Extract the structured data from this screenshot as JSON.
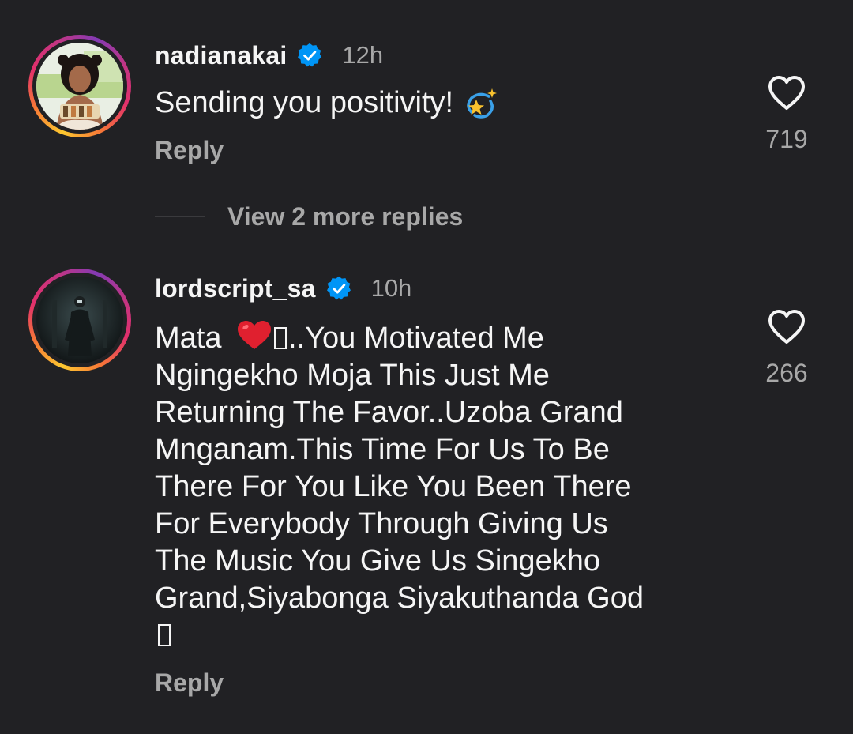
{
  "comments": [
    {
      "username": "nadianakai",
      "verified": true,
      "timestamp": "12h",
      "text": "Sending you positivity!",
      "emoji": "dizzy-star-emoji",
      "reply_label": "Reply",
      "like_count": "719"
    },
    {
      "username": "lordscript_sa",
      "verified": true,
      "timestamp": "10h",
      "text_lines": [
        "Mata",
        "..You Motivated Me",
        "Ngingekho Moja This Just Me",
        "Returning The Favor..Uzoba Grand",
        "Mnganam.This Time For Us To Be",
        "There For You Like You Been There",
        "For Everybody Through Giving Us",
        "The Music You Give Us Singekho",
        "Grand,Siyabonga Siyakuthanda God"
      ],
      "reply_label": "Reply",
      "like_count": "266"
    }
  ],
  "view_more_replies": "View 2 more replies",
  "colors": {
    "background": "#212124",
    "text": "#f5f5f5",
    "muted": "#a8a8a8",
    "verified": "#0095f6",
    "heart_emoji": "#e0202f"
  }
}
